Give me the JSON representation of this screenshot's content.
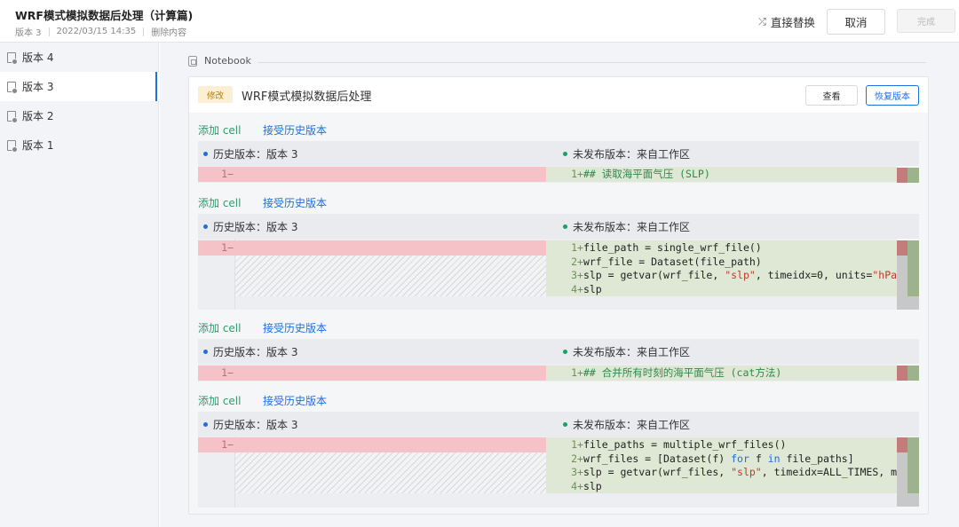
{
  "header": {
    "title": "WRF模式模拟数据后处理（计算篇)",
    "version": "版本 3",
    "datetime": "2022/03/15 14:35",
    "delete_label": "删除内容",
    "replace_label": "直接替换",
    "cancel_label": "取消",
    "done_label": "完成"
  },
  "sidebar": {
    "items": [
      {
        "label": "版本 4"
      },
      {
        "label": "版本 3"
      },
      {
        "label": "版本 2"
      },
      {
        "label": "版本 1"
      }
    ]
  },
  "notebook": {
    "label": "Notebook",
    "tag": "修改",
    "title": "WRF模式模拟数据后处理",
    "view_label": "查看",
    "restore_label": "恢复版本"
  },
  "common": {
    "add_cell": "添加 cell",
    "accept": "接受历史版本",
    "left_header": "历史版本：版本 3",
    "right_header": "未发布版本：来自工作区",
    "left_line": "1−"
  },
  "cells": [
    {
      "right_lines": [
        {
          "num": "1",
          "prefix": "+",
          "parts": [
            {
              "t": "## 读取海平面气压 (SLP)",
              "c": "cm"
            }
          ]
        }
      ]
    },
    {
      "right_lines": [
        {
          "num": "1",
          "prefix": "+",
          "parts": [
            {
              "t": "file_path = single_wrf_file()",
              "c": ""
            }
          ]
        },
        {
          "num": "2",
          "prefix": "+",
          "parts": [
            {
              "t": "wrf_file = Dataset(file_path)",
              "c": ""
            }
          ]
        },
        {
          "num": "3",
          "prefix": "+",
          "parts": [
            {
              "t": "slp = getvar(wrf_file, ",
              "c": ""
            },
            {
              "t": "\"slp\"",
              "c": "str"
            },
            {
              "t": ", timeidx=0, units=",
              "c": ""
            },
            {
              "t": "\"hPa",
              "c": "str"
            }
          ]
        },
        {
          "num": "4",
          "prefix": "+",
          "parts": [
            {
              "t": "slp",
              "c": ""
            }
          ]
        }
      ]
    },
    {
      "right_lines": [
        {
          "num": "1",
          "prefix": "+",
          "parts": [
            {
              "t": "## 合并所有时刻的海平面气压 (cat方法)",
              "c": "cm"
            }
          ]
        }
      ]
    },
    {
      "right_lines": [
        {
          "num": "1",
          "prefix": "+",
          "parts": [
            {
              "t": "file_paths = multiple_wrf_files()",
              "c": ""
            }
          ]
        },
        {
          "num": "2",
          "prefix": "+",
          "parts": [
            {
              "t": "wrf_files = [Dataset(f) ",
              "c": ""
            },
            {
              "t": "for",
              "c": "kw"
            },
            {
              "t": " f ",
              "c": ""
            },
            {
              "t": "in",
              "c": "kw"
            },
            {
              "t": " file_paths]",
              "c": ""
            }
          ]
        },
        {
          "num": "3",
          "prefix": "+",
          "parts": [
            {
              "t": "slp = getvar(wrf_files, ",
              "c": ""
            },
            {
              "t": "\"slp\"",
              "c": "str"
            },
            {
              "t": ", timeidx=ALL_TIMES, m",
              "c": ""
            }
          ]
        },
        {
          "num": "4",
          "prefix": "+",
          "parts": [
            {
              "t": "slp",
              "c": ""
            }
          ]
        }
      ]
    }
  ]
}
